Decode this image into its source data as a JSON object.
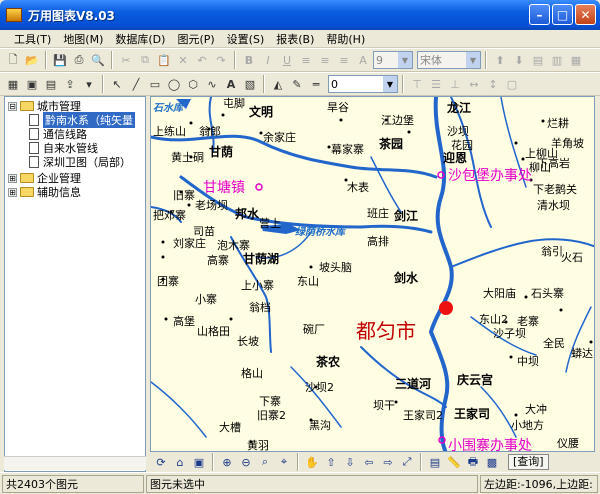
{
  "window": {
    "title": "万用图表V8.03"
  },
  "menu": [
    "工具(T)",
    "地图(M)",
    "数据库(D)",
    "图元(P)",
    "设置(S)",
    "报表(B)",
    "帮助(H)"
  ],
  "toolbar": {
    "font_size": "9",
    "font_name": "宋体",
    "line_width": "0"
  },
  "tree": [
    {
      "label": "城市管理",
      "level": 0,
      "expander": "⊟"
    },
    {
      "label": "黔南水系（纯矢量",
      "level": 1,
      "selected": true
    },
    {
      "label": "通信线路",
      "level": 1
    },
    {
      "label": "自来水管线",
      "level": 1
    },
    {
      "label": "深圳卫图（局部）",
      "level": 1
    },
    {
      "label": "企业管理",
      "level": 0,
      "expander": "⊞"
    },
    {
      "label": "辅助信息",
      "level": 0,
      "expander": "⊞"
    }
  ],
  "map": {
    "city": "都匀市",
    "reservoir": "绿荫桥水库",
    "corner_water": "石水库",
    "places": [
      "甘塘镇",
      "沙包堡办事处",
      "小围寨办事处"
    ],
    "towns": [
      "文明",
      "龙江",
      "甘荫",
      "茶园",
      "迎恩",
      "邦水",
      "剑江",
      "甘荫湖",
      "剑水",
      "茶农",
      "庆云宫",
      "三道河",
      "王家司"
    ],
    "villages": [
      "屯脚",
      "上练山",
      "翁郎",
      "黄土硐",
      "余家庄",
      "旱谷",
      "江边堡",
      "沙坝",
      "幕家寨",
      "花园",
      "木表",
      "烂耕",
      "羊角坡",
      "上柳山",
      "柳山",
      "下高岩",
      "下老鹅关",
      "清水坝",
      "旧寨",
      "老场坝",
      "把邓寨",
      "司苗",
      "刘家庄",
      "泡木寨",
      "高寨",
      "营上",
      "班庄",
      "高排",
      "翁引",
      "火石",
      "团寨",
      "坡头脑",
      "东山",
      "上小寨",
      "小寨",
      "高堡",
      "翁档",
      "山格田",
      "长坡",
      "碗厂",
      "大阳庙",
      "石头寨",
      "东山2",
      "沙子坝",
      "老寨",
      "全民",
      "中坝",
      "蟒达",
      "格山",
      "沙坝2",
      "下寨",
      "旧寨2",
      "坝干",
      "大槽",
      "黄羽",
      "黑沟",
      "王家司2",
      "小地方",
      "大冲",
      "仪腰"
    ]
  },
  "nav": {
    "query_label": "[查询]"
  },
  "status": {
    "count": "共2403个图元",
    "selection": "图元未选中",
    "coords": "左边距:-1096,上边距:"
  }
}
